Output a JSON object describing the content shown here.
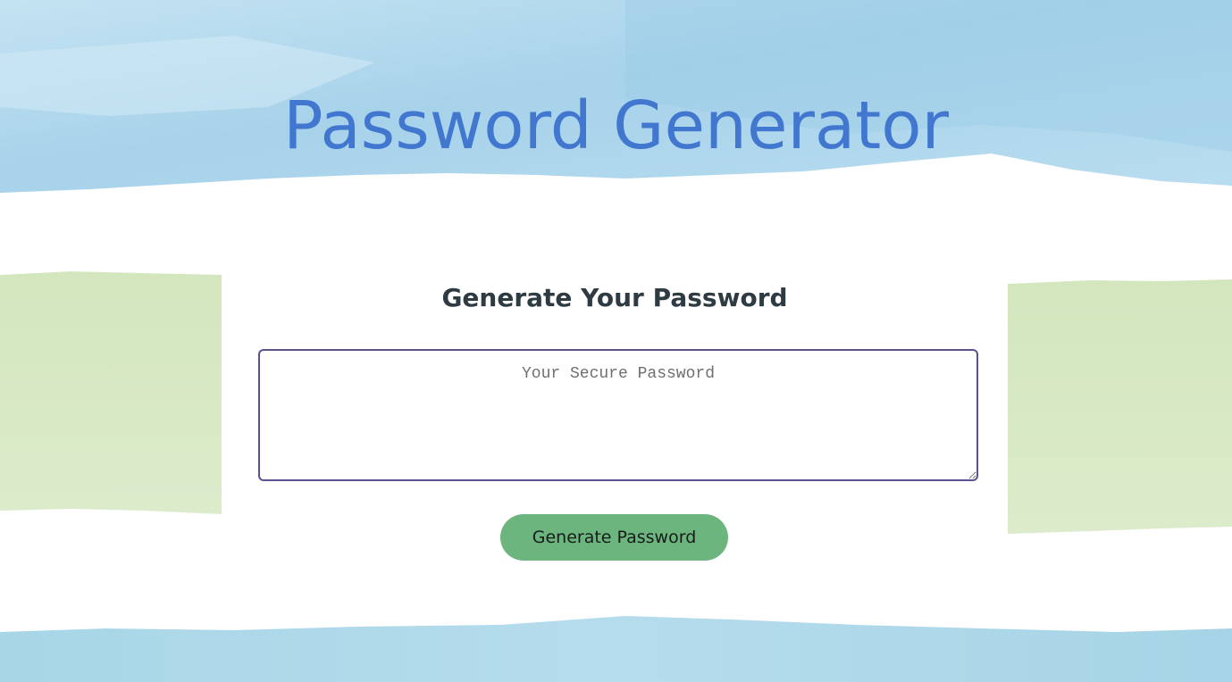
{
  "header": {
    "title": "Password Generator"
  },
  "card": {
    "title": "Generate Your Password",
    "password": {
      "value": "",
      "placeholder": "Your Secure Password"
    },
    "generate_button_label": "Generate Password"
  },
  "colors": {
    "title": "#4177cf",
    "button": "#6db57e",
    "textarea_border": "#5b5390",
    "watercolor_blue": "#a9d3ea",
    "watercolor_green": "#d9e9c3"
  }
}
